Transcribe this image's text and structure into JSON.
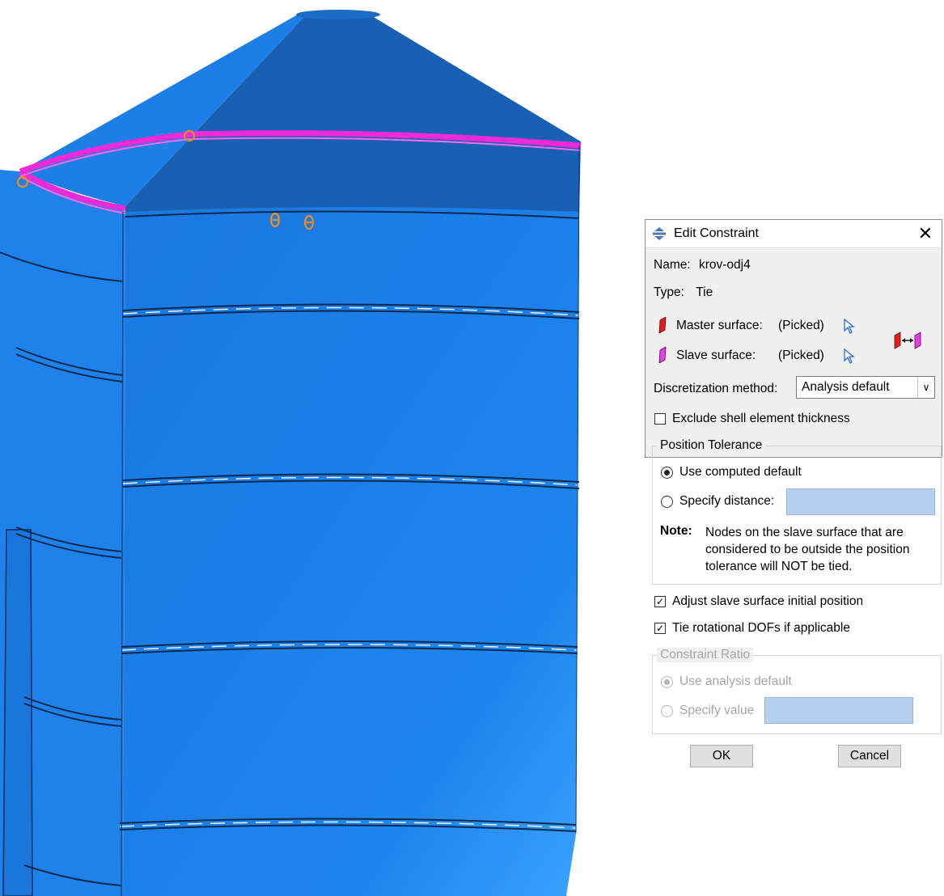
{
  "dialog": {
    "title": "Edit Constraint",
    "close_glyph": "✕",
    "name_label": "Name:",
    "name_value": "krov-odj4",
    "type_label": "Type:",
    "type_value": "Tie",
    "master_label": "Master surface:",
    "master_value": "(Picked)",
    "slave_label": "Slave surface:",
    "slave_value": "(Picked)",
    "disc_label": "Discretization method:",
    "disc_value": "Analysis default",
    "exclude_label": "Exclude shell element thickness",
    "exclude_checked": false,
    "position_group_title": "Position Tolerance",
    "use_computed_label": "Use computed default",
    "specify_distance_label": "Specify distance:",
    "specify_distance_value": "",
    "note_label": "Note:",
    "note_line1": "Nodes on the slave surface that are",
    "note_line2": "considered to be outside the position",
    "note_line3": "tolerance will NOT be tied.",
    "adjust_label": "Adjust slave surface initial position",
    "adjust_checked": true,
    "tie_rot_label": "Tie rotational DOFs if applicable",
    "tie_rot_checked": true,
    "ratio_group_title": "Constraint Ratio",
    "use_analysis_label": "Use analysis default",
    "specify_value_label": "Specify value",
    "specify_value_value": "",
    "ok_label": "OK",
    "cancel_label": "Cancel",
    "check_glyph": "✓",
    "dropdown_glyph": "∨"
  },
  "icons": {
    "title": "constraint-icon",
    "master": "master-surface-icon",
    "slave": "slave-surface-icon",
    "pick": "select-cursor-icon",
    "tie": "tie-constraint-icon"
  },
  "colors": {
    "model_blue": "#1e82ea",
    "model_dark_blue": "#1860b4",
    "highlight_magenta": "#f02ad8",
    "marker_orange": "#ee8a1e",
    "dialog_bg": "#f0f0f0",
    "field_blue": "#b7d0ef"
  }
}
